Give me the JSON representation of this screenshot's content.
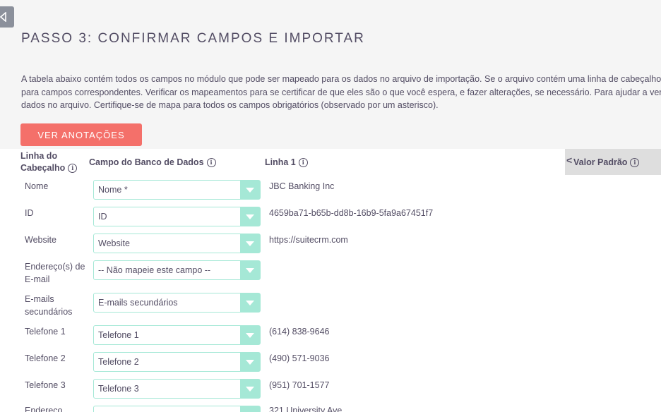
{
  "page": {
    "title": "PASSO 3: CONFIRMAR CAMPOS E IMPORTAR",
    "description_lines": [
      "A tabela abaixo contém todos os campos no módulo que pode ser mapeado para os dados no arquivo de importação. Se o arquivo contém uma linha de cabeçalho, a",
      "para campos correspondentes. Verificar os mapeamentos para se certificar de que eles são o que você espera, e fazer alterações, se necessário. Para ajudar a verifi",
      "dados no arquivo. Certifique-se de mapa para todos os campos obrigatórios (observado por um asterisco)."
    ],
    "notes_button_label": "VER ANOTAÇÕES"
  },
  "table": {
    "headers": {
      "header_row_line1": "Linha do",
      "header_row_line2": "Cabeçalho",
      "db_field": "Campo do Banco de Dados",
      "row1": "Linha 1",
      "default_value": "Valor Padrão",
      "collapse_glyph": "<",
      "info_glyph": "i"
    },
    "rows": [
      {
        "label": "Nome",
        "field": "Nome *",
        "value": "JBC Banking Inc"
      },
      {
        "label": "ID",
        "field": "ID",
        "value": "4659ba71-b65b-dd8b-16b9-5fa9a67451f7"
      },
      {
        "label": "Website",
        "field": "Website",
        "value": "https://suitecrm.com"
      },
      {
        "label": "Endereço(s) de E-mail",
        "field": "-- Não mapeie este campo --",
        "value": ""
      },
      {
        "label": "E-mails secundários",
        "field": "E-mails secundários",
        "value": ""
      },
      {
        "label": "Telefone 1",
        "field": "Telefone 1",
        "value": "(614) 838-9646"
      },
      {
        "label": "Telefone 2",
        "field": "Telefone 2",
        "value": "(490) 571-9036"
      },
      {
        "label": "Telefone 3",
        "field": "Telefone 3",
        "value": "(951) 701-1577"
      },
      {
        "label": "Endereço",
        "field": "",
        "value": "321 University Ave."
      }
    ]
  },
  "icons": {
    "collapse": "collapse-left-icon",
    "info": "info-icon",
    "dropdown": "chevron-down-icon"
  },
  "colors": {
    "accent": "#f4706a",
    "select_border": "#a5e8d6",
    "text": "#534d64"
  }
}
